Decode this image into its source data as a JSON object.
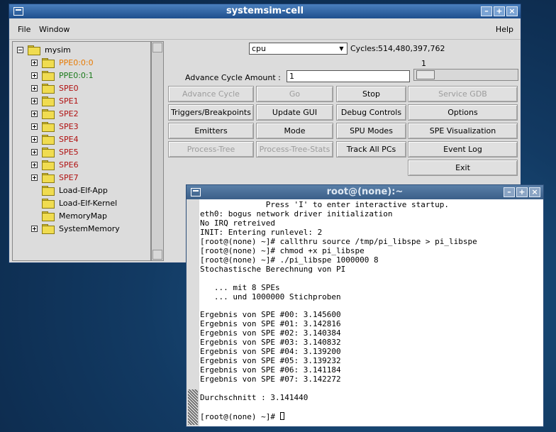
{
  "main_window": {
    "title": "systemsim-cell",
    "menu": {
      "file": "File",
      "window": "Window",
      "help": "Help"
    },
    "tree": {
      "root": "mysim",
      "items": [
        {
          "label": "PPE0:0:0",
          "color": "#e87a00",
          "expander": true
        },
        {
          "label": "PPE0:0:1",
          "color": "#1a7a1a",
          "expander": true
        },
        {
          "label": "SPE0",
          "color": "#b01010",
          "expander": true
        },
        {
          "label": "SPE1",
          "color": "#b01010",
          "expander": true
        },
        {
          "label": "SPE2",
          "color": "#b01010",
          "expander": true
        },
        {
          "label": "SPE3",
          "color": "#b01010",
          "expander": true
        },
        {
          "label": "SPE4",
          "color": "#b01010",
          "expander": true
        },
        {
          "label": "SPE5",
          "color": "#b01010",
          "expander": true
        },
        {
          "label": "SPE6",
          "color": "#b01010",
          "expander": true
        },
        {
          "label": "SPE7",
          "color": "#b01010",
          "expander": true
        },
        {
          "label": "Load-Elf-App",
          "color": "#000000",
          "expander": false
        },
        {
          "label": "Load-Elf-Kernel",
          "color": "#000000",
          "expander": false
        },
        {
          "label": "MemoryMap",
          "color": "#000000",
          "expander": false
        },
        {
          "label": "SystemMemory",
          "color": "#000000",
          "expander": true
        }
      ]
    },
    "cpu_select": "cpu",
    "cycles_label": "Cycles:",
    "cycles_value": "514,480,397,762",
    "slider_value": "1",
    "advance_label": "Advance Cycle Amount :",
    "advance_value": "1",
    "buttons": {
      "advance_cycle": "Advance Cycle",
      "go": "Go",
      "stop": "Stop",
      "service_gdb": "Service GDB",
      "triggers": "Triggers/Breakpoints",
      "update_gui": "Update GUI",
      "debug_controls": "Debug Controls",
      "options": "Options",
      "emitters": "Emitters",
      "mode": "Mode",
      "spu_modes": "SPU Modes",
      "spe_visualization": "SPE Visualization",
      "process_tree": "Process-Tree",
      "process_tree_stats": "Process-Tree-Stats",
      "track_all_pcs": "Track All PCs",
      "event_log": "Event Log",
      "exit": "Exit"
    }
  },
  "terminal": {
    "title": "root@(none):~",
    "lines": [
      "              Press 'I' to enter interactive startup.",
      "eth0: bogus network driver initialization",
      "No IRQ retreived",
      "INIT: Entering runlevel: 2",
      "[root@(none) ~]# callthru source /tmp/pi_libspe > pi_libspe",
      "[root@(none) ~]# chmod +x pi_libspe",
      "[root@(none) ~]# ./pi_libspe 1000000 8",
      "Stochastische Berechnung von PI",
      "",
      "   ... mit 8 SPEs",
      "   ... und 1000000 Stichproben",
      "",
      "Ergebnis von SPE #00: 3.145600",
      "Ergebnis von SPE #01: 3.142816",
      "Ergebnis von SPE #02: 3.140384",
      "Ergebnis von SPE #03: 3.140832",
      "Ergebnis von SPE #04: 3.139200",
      "Ergebnis von SPE #05: 3.139232",
      "Ergebnis von SPE #06: 3.141184",
      "Ergebnis von SPE #07: 3.142272",
      "",
      "Durchschnitt : 3.141440",
      ""
    ],
    "prompt": "[root@(none) ~]# "
  }
}
